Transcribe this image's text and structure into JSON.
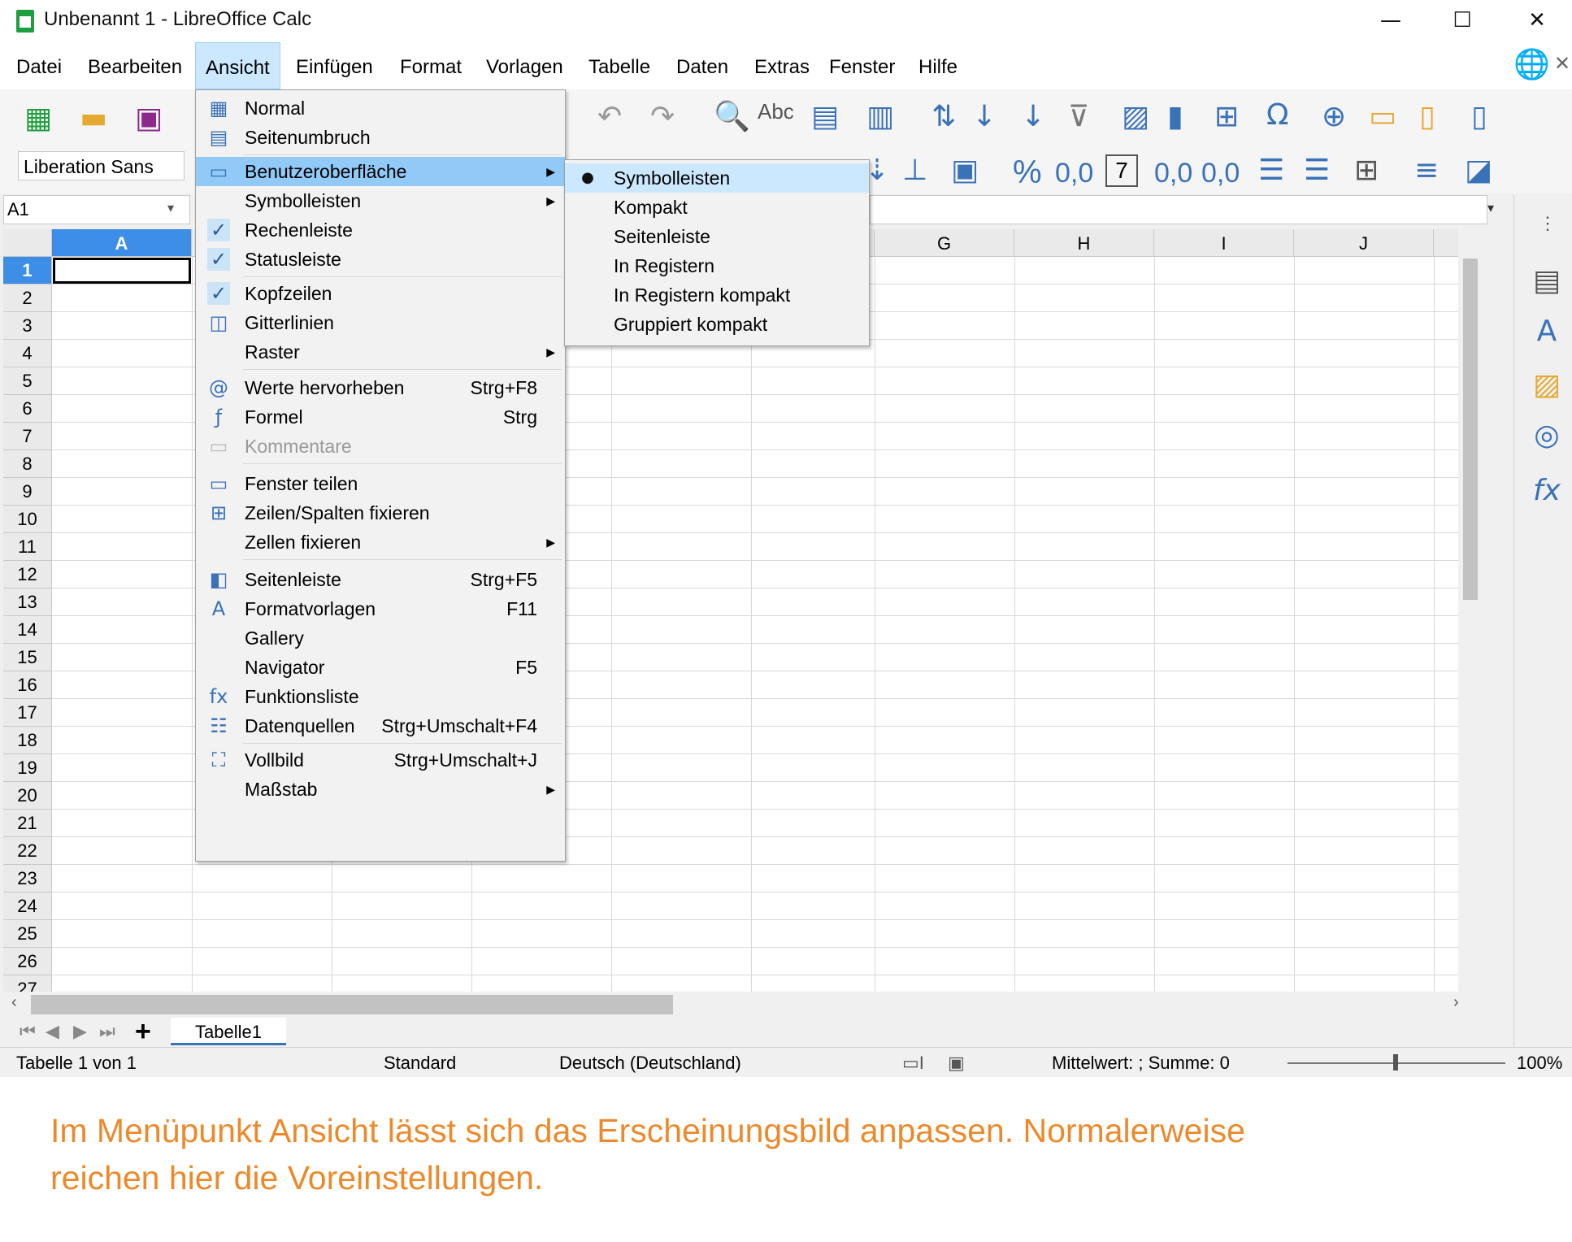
{
  "window": {
    "title": "Unbenannt 1 - LibreOffice Calc",
    "minimize": "—",
    "maximize": "☐",
    "close": "✕"
  },
  "menubar": [
    {
      "label": "Datei"
    },
    {
      "label": "Bearbeiten"
    },
    {
      "label": "Ansicht"
    },
    {
      "label": "Einfügen"
    },
    {
      "label": "Format"
    },
    {
      "label": "Vorlagen"
    },
    {
      "label": "Tabelle"
    },
    {
      "label": "Daten"
    },
    {
      "label": "Extras"
    },
    {
      "label": "Fenster"
    },
    {
      "label": "Hilfe"
    }
  ],
  "toolbar": {
    "font_name": "Liberation Sans",
    "percent": "%",
    "decimal": "0,0",
    "seven": "7",
    "add_decimal": "0,0",
    "del_decimal": "0,0"
  },
  "formula": {
    "cell_ref": "A1"
  },
  "grid": {
    "columns": [
      "A",
      "G",
      "H",
      "I",
      "J"
    ],
    "rows": [
      "1",
      "2",
      "3",
      "4",
      "5",
      "6",
      "7",
      "8",
      "9",
      "10",
      "11",
      "12",
      "13",
      "14",
      "15",
      "16",
      "17",
      "18",
      "19",
      "20",
      "21",
      "22",
      "23",
      "24",
      "25",
      "26",
      "27"
    ]
  },
  "ansicht_menu": {
    "items": [
      {
        "label": "Normal",
        "accel": "",
        "icon": "grid-icon"
      },
      {
        "label": "Seitenumbruch",
        "accel": "",
        "icon": "pagebreak-icon"
      },
      {
        "label": "Benutzeroberfläche",
        "accel": "",
        "icon": "ui-icon",
        "submenu": true
      },
      {
        "label": "Symbolleisten",
        "accel": "",
        "submenu": true
      },
      {
        "label": "Rechenleiste",
        "accel": "",
        "checked": true
      },
      {
        "label": "Statusleiste",
        "accel": "",
        "checked": true
      },
      {
        "label": "Kopfzeilen",
        "accel": "",
        "checked": true
      },
      {
        "label": "Gitterlinien",
        "accel": "",
        "icon": "gridlines-icon"
      },
      {
        "label": "Raster",
        "accel": "",
        "submenu": true
      },
      {
        "label": "Werte hervorheben",
        "accel": "Strg+F8",
        "icon": "at-icon"
      },
      {
        "label": "Formel",
        "accel": "Strg",
        "icon": "formula-icon"
      },
      {
        "label": "Kommentare",
        "accel": "",
        "icon": "comment-icon",
        "disabled": true
      },
      {
        "label": "Fenster teilen",
        "accel": "",
        "icon": "split-icon"
      },
      {
        "label": "Zeilen/Spalten fixieren",
        "accel": "",
        "icon": "freeze-icon"
      },
      {
        "label": "Zellen fixieren",
        "accel": "",
        "submenu": true
      },
      {
        "label": "Seitenleiste",
        "accel": "Strg+F5",
        "icon": "sidebar-icon"
      },
      {
        "label": "Formatvorlagen",
        "accel": "F11",
        "icon": "styles-icon"
      },
      {
        "label": "Gallery",
        "accel": ""
      },
      {
        "label": "Navigator",
        "accel": "F5"
      },
      {
        "label": "Funktionsliste",
        "accel": "",
        "icon": "fx-icon"
      },
      {
        "label": "Datenquellen",
        "accel": "Strg+Umschalt+F4",
        "icon": "database-icon"
      },
      {
        "label": "Vollbild",
        "accel": "Strg+Umschalt+J",
        "icon": "fullscreen-icon"
      },
      {
        "label": "Maßstab",
        "accel": "",
        "submenu": true
      }
    ]
  },
  "ui_submenu": {
    "items": [
      {
        "label": "Symbolleisten",
        "selected": true
      },
      {
        "label": "Kompakt"
      },
      {
        "label": "Seitenleiste"
      },
      {
        "label": "In Registern"
      },
      {
        "label": "In Registern kompakt"
      },
      {
        "label": "Gruppiert kompakt"
      }
    ]
  },
  "sheet": {
    "tab": "Tabelle1"
  },
  "status": {
    "sheet_pos": "Tabelle 1 von 1",
    "style": "Standard",
    "language": "Deutsch (Deutschland)",
    "summary": "Mittelwert: ; Summe: 0",
    "zoom": "100%"
  },
  "caption": {
    "line1": "Im Menüpunkt Ansicht lässt sich das Erscheinungsbild anpassen. Normalerweise",
    "line2": "reichen hier die Voreinstellungen."
  },
  "colors": {
    "accent": "#3a72b8",
    "selection": "#91c9f7",
    "caption": "#ec8a2b"
  }
}
